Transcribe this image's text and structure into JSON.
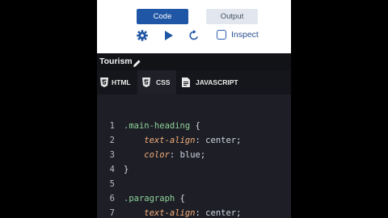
{
  "toolbar": {
    "code_label": "Code",
    "output_label": "Output",
    "inspect_label": "Inspect"
  },
  "project": {
    "title": "Tourism"
  },
  "tabs": [
    {
      "label": "HTML",
      "icon": "html5-icon",
      "active": false
    },
    {
      "label": "CSS",
      "icon": "css3-icon",
      "active": true
    },
    {
      "label": "JAVASCRIPT",
      "icon": "file-icon",
      "active": false
    }
  ],
  "editor": {
    "lines": [
      {
        "n": "1",
        "tokens": [
          {
            "t": ".main-heading",
            "c": "sel"
          },
          {
            "t": " {",
            "c": "punc"
          }
        ]
      },
      {
        "n": "2",
        "tokens": [
          {
            "t": "    text-align",
            "c": "prop"
          },
          {
            "t": ": ",
            "c": "punc"
          },
          {
            "t": "center",
            "c": "val"
          },
          {
            "t": ";",
            "c": "punc"
          }
        ]
      },
      {
        "n": "3",
        "tokens": [
          {
            "t": "    color",
            "c": "prop"
          },
          {
            "t": ": ",
            "c": "punc"
          },
          {
            "t": "blue",
            "c": "val"
          },
          {
            "t": ";",
            "c": "punc"
          }
        ]
      },
      {
        "n": "4",
        "tokens": [
          {
            "t": "}",
            "c": "punc"
          }
        ]
      },
      {
        "n": "5",
        "tokens": []
      },
      {
        "n": "6",
        "tokens": [
          {
            "t": ".paragraph",
            "c": "sel"
          },
          {
            "t": " {",
            "c": "punc"
          }
        ]
      },
      {
        "n": "7",
        "tokens": [
          {
            "t": "    text-align",
            "c": "prop"
          },
          {
            "t": ": ",
            "c": "punc"
          },
          {
            "t": "center",
            "c": "val"
          },
          {
            "t": ";",
            "c": "punc"
          }
        ]
      }
    ]
  },
  "colors": {
    "primary": "#1f56a5",
    "selector": "#8fd19a",
    "property": "#f3ad7a",
    "editor_bg": "#1e1f26"
  }
}
